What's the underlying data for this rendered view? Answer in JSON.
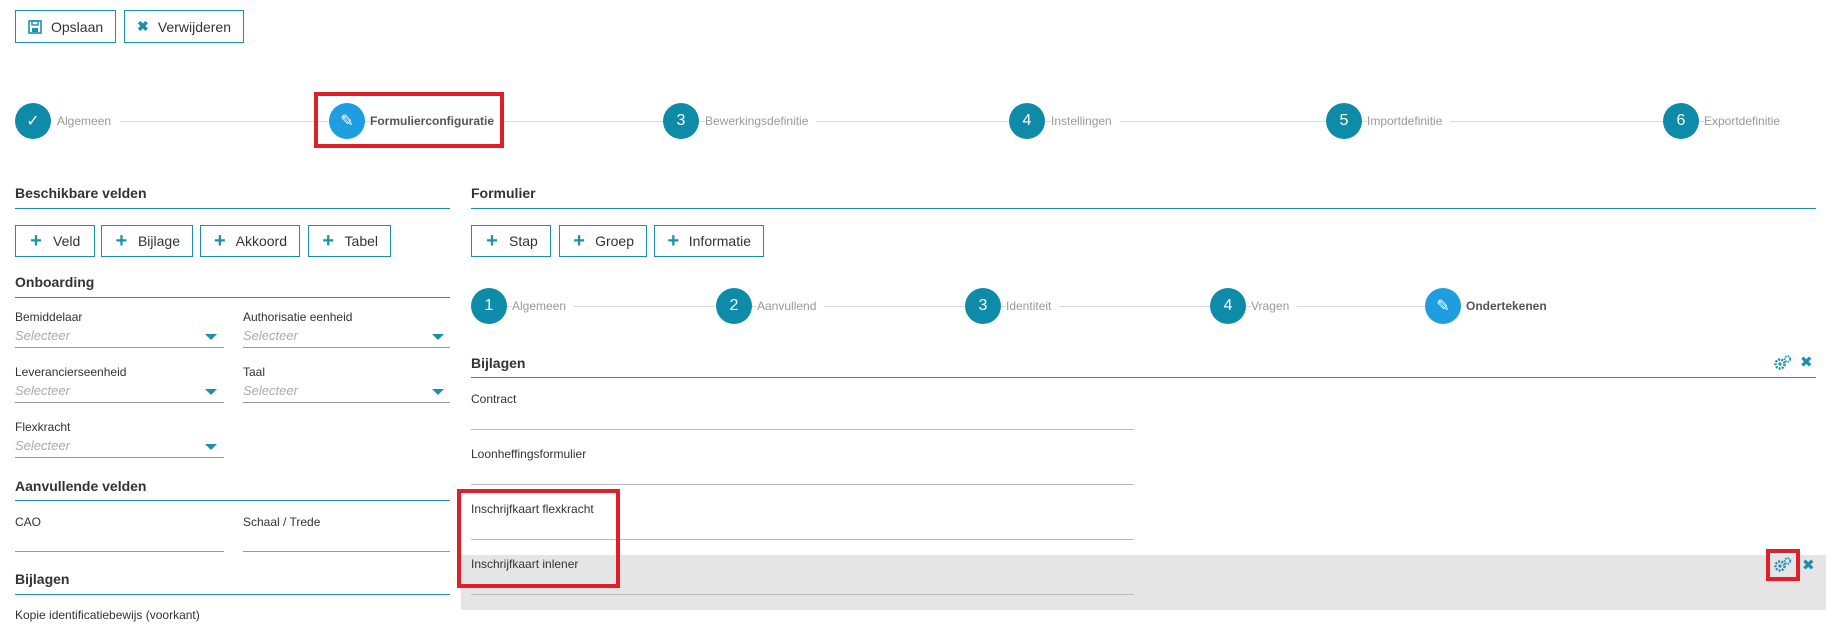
{
  "toolbar": {
    "save_label": "Opslaan",
    "delete_label": "Verwijderen"
  },
  "wizard": {
    "steps": [
      {
        "marker": "✓",
        "label": "Algemeen"
      },
      {
        "marker": "✎",
        "label": "Formulierconfiguratie"
      },
      {
        "marker": "3",
        "label": "Bewerkingsdefinitie"
      },
      {
        "marker": "4",
        "label": "Instellingen"
      },
      {
        "marker": "5",
        "label": "Importdefinitie"
      },
      {
        "marker": "6",
        "label": "Exportdefinitie"
      }
    ]
  },
  "left": {
    "available_title": "Beschikbare velden",
    "add_buttons": [
      "Veld",
      "Bijlage",
      "Akkoord",
      "Tabel"
    ],
    "onboarding_title": "Onboarding",
    "fields": [
      {
        "label": "Bemiddelaar",
        "placeholder": "Selecteer"
      },
      {
        "label": "Authorisatie eenheid",
        "placeholder": "Selecteer"
      },
      {
        "label": "Leverancierseenheid",
        "placeholder": "Selecteer"
      },
      {
        "label": "Taal",
        "placeholder": "Selecteer"
      },
      {
        "label": "Flexkracht",
        "placeholder": "Selecteer"
      }
    ],
    "extra_title": "Aanvullende velden",
    "extra_fields": [
      "CAO",
      "Schaal / Trede"
    ],
    "attachments_title": "Bijlagen",
    "attachments": [
      "Kopie identificatiebewijs (voorkant)"
    ]
  },
  "form": {
    "title": "Formulier",
    "add_buttons": [
      "Stap",
      "Groep",
      "Informatie"
    ],
    "steps": [
      {
        "marker": "1",
        "label": "Algemeen"
      },
      {
        "marker": "2",
        "label": "Aanvullend"
      },
      {
        "marker": "3",
        "label": "Identiteit"
      },
      {
        "marker": "4",
        "label": "Vragen"
      },
      {
        "marker": "✎",
        "label": "Ondertekenen"
      }
    ],
    "group_title": "Bijlagen",
    "items": [
      "Contract",
      "Loonheffingsformulier",
      "Inschrijfkaart flexkracht",
      "Inschrijfkaart inlener"
    ]
  },
  "colors": {
    "accent": "#1a8fae",
    "step": "#0e8ba8",
    "active_step": "#1e9ee0",
    "highlight": "#e11f2b"
  }
}
